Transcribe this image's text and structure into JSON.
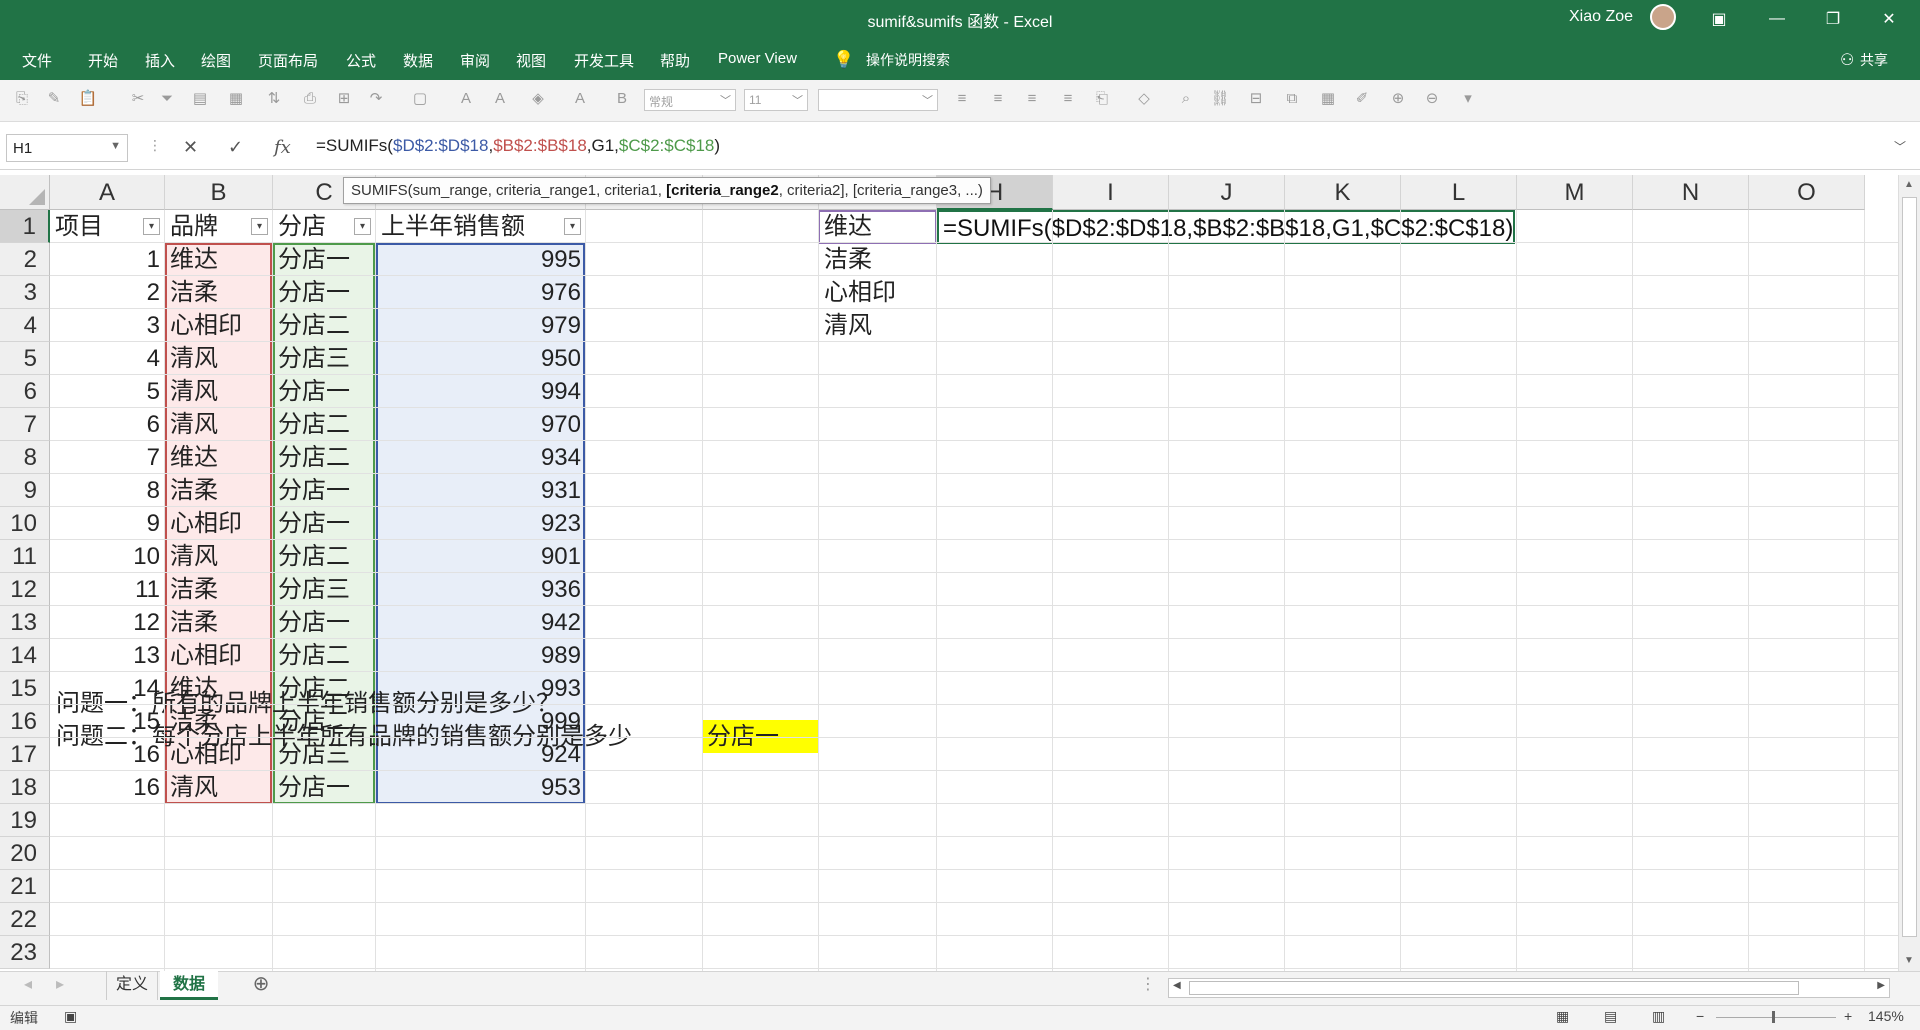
{
  "title": {
    "doc": "sumif&sumifs 函数 - Excel",
    "user": "Xiao Zoe"
  },
  "menu": [
    "文件",
    "开始",
    "插入",
    "绘图",
    "页面布局",
    "公式",
    "数据",
    "审阅",
    "视图",
    "开发工具",
    "帮助",
    "Power View",
    "操作说明搜索"
  ],
  "share": "共享",
  "toolbar": {
    "number_format": "常规",
    "font_size": "11"
  },
  "formula": {
    "name_box": "H1",
    "fx": "fx",
    "prefix": "=SUMIFs(",
    "ref1": "$D$2:$D$18",
    "sep1": ",",
    "ref2": "$B$2:$B$18",
    "sep2": ",G1,",
    "ref3": "$C$2:$C$18",
    "suffix": ")"
  },
  "tooltip": {
    "pre": "SUMIFS(sum_range, criteria_range1, criteria1, ",
    "bold": "[criteria_range2",
    "post": ", criteria2], [criteria_range3, ...)"
  },
  "columns": [
    "A",
    "B",
    "C",
    "D",
    "E",
    "F",
    "G",
    "H",
    "I",
    "J",
    "K",
    "L",
    "M",
    "N",
    "O"
  ],
  "rows": [
    "1",
    "2",
    "3",
    "4",
    "5",
    "6",
    "7",
    "8",
    "9",
    "10",
    "11",
    "12",
    "13",
    "14",
    "15",
    "16",
    "17",
    "18",
    "19",
    "20",
    "21",
    "22",
    "23"
  ],
  "table": {
    "headers": [
      "项目",
      "品牌",
      "分店",
      "上半年销售额"
    ],
    "data": [
      [
        "1",
        "维达",
        "分店一",
        "995"
      ],
      [
        "2",
        "洁柔",
        "分店一",
        "976"
      ],
      [
        "3",
        "心相印",
        "分店二",
        "979"
      ],
      [
        "4",
        "清风",
        "分店三",
        "950"
      ],
      [
        "5",
        "清风",
        "分店一",
        "994"
      ],
      [
        "6",
        "清风",
        "分店二",
        "970"
      ],
      [
        "7",
        "维达",
        "分店二",
        "934"
      ],
      [
        "8",
        "洁柔",
        "分店一",
        "931"
      ],
      [
        "9",
        "心相印",
        "分店一",
        "923"
      ],
      [
        "10",
        "清风",
        "分店二",
        "901"
      ],
      [
        "11",
        "洁柔",
        "分店三",
        "936"
      ],
      [
        "12",
        "洁柔",
        "分店一",
        "942"
      ],
      [
        "13",
        "心相印",
        "分店二",
        "989"
      ],
      [
        "14",
        "维达",
        "分店二",
        "993"
      ],
      [
        "15",
        "洁柔",
        "分店二",
        "999"
      ],
      [
        "16",
        "心相印",
        "分店三",
        "924"
      ],
      [
        "16",
        "清风",
        "分店一",
        "953"
      ]
    ]
  },
  "brands_list": [
    "维达",
    "洁柔",
    "心相印",
    "清风"
  ],
  "edit_cell": "=SUMIFs($D$2:$D$18,$B$2:$B$18,G1,$C$2:$C$18)",
  "question1": "问题一：所有的品牌上半年销售额分别是多少？",
  "question2": "问题二：每个分店上半年所有品牌的销售额分别是多少",
  "question2_highlight": "分店一",
  "sheet_tabs": [
    "定义",
    "数据"
  ],
  "status": {
    "mode": "编辑",
    "zoom": "145%"
  },
  "colors": {
    "excel_green": "#217346",
    "highlight_yellow": "#ffff00",
    "ref_blue": "#3c5aa6",
    "ref_red": "#c0504d",
    "ref_green": "#4e9a4a"
  }
}
